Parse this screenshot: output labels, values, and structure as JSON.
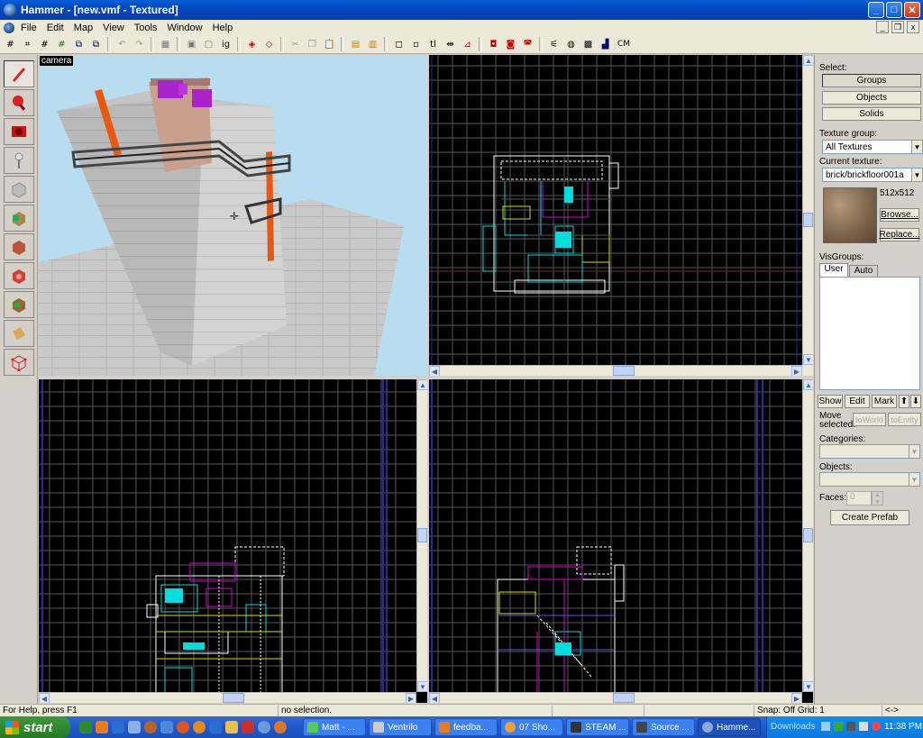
{
  "window": {
    "title": "Hammer - [new.vmf - Textured]",
    "min": "_",
    "max": "□",
    "close": "✕"
  },
  "menu": [
    "File",
    "Edit",
    "Map",
    "View",
    "Tools",
    "Window",
    "Help"
  ],
  "toolbar": {
    "cm_label": "CM"
  },
  "viewports": {
    "camera_label": "camera"
  },
  "panel": {
    "select_label": "Select:",
    "groups": "Groups",
    "objects": "Objects",
    "solids": "Solids",
    "texture_group_label": "Texture group:",
    "texture_group_value": "All Textures",
    "current_texture_label": "Current texture:",
    "current_texture_value": "brick/brickfloor001a",
    "texture_size": "512x512",
    "browse": "Browse...",
    "replace": "Replace...",
    "visgroups_label": "VisGroups:",
    "tab_user": "User",
    "tab_auto": "Auto",
    "show": "Show",
    "edit": "Edit",
    "mark": "Mark",
    "up": "⬆",
    "down": "⬇",
    "move_selected": "Move selected:",
    "to_world": "toWorld",
    "to_entity": "toEntity",
    "categories_label": "Categories:",
    "objects_label": "Objects:",
    "faces_label": "Faces:",
    "faces_value": "0",
    "create_prefab": "Create Prefab"
  },
  "status": {
    "help": "For Help, press F1",
    "selection": "no selection.",
    "snap": "Snap: Off Grid: 1",
    "extra": "<->"
  },
  "taskbar": {
    "start": "start",
    "tasks": [
      "Matt - ...",
      "Ventrilo",
      "feedba...",
      "07 Sho...",
      "STEAM ...",
      "Source ...",
      "Hamme..."
    ],
    "downloads": "Downloads",
    "clock": "11:38 PM"
  },
  "colors": {
    "titlebar": "#0047c0",
    "viewport_bg": "#000000",
    "grid": "#5a5a5a",
    "brush_white": "#ffffff",
    "brush_cyan": "#00e5e5",
    "brush_magenta": "#e600e6",
    "brush_yellow": "#e5e500",
    "sky": "#b8dcf0"
  },
  "icons": [
    "selection-tool-icon",
    "magnify-tool-icon",
    "camera-tool-icon",
    "entity-tool-icon",
    "block-tool-icon",
    "texture-application-icon",
    "apply-texture-icon",
    "decal-icon",
    "overlay-icon",
    "clipping-tool-icon",
    "vertex-tool-icon"
  ]
}
